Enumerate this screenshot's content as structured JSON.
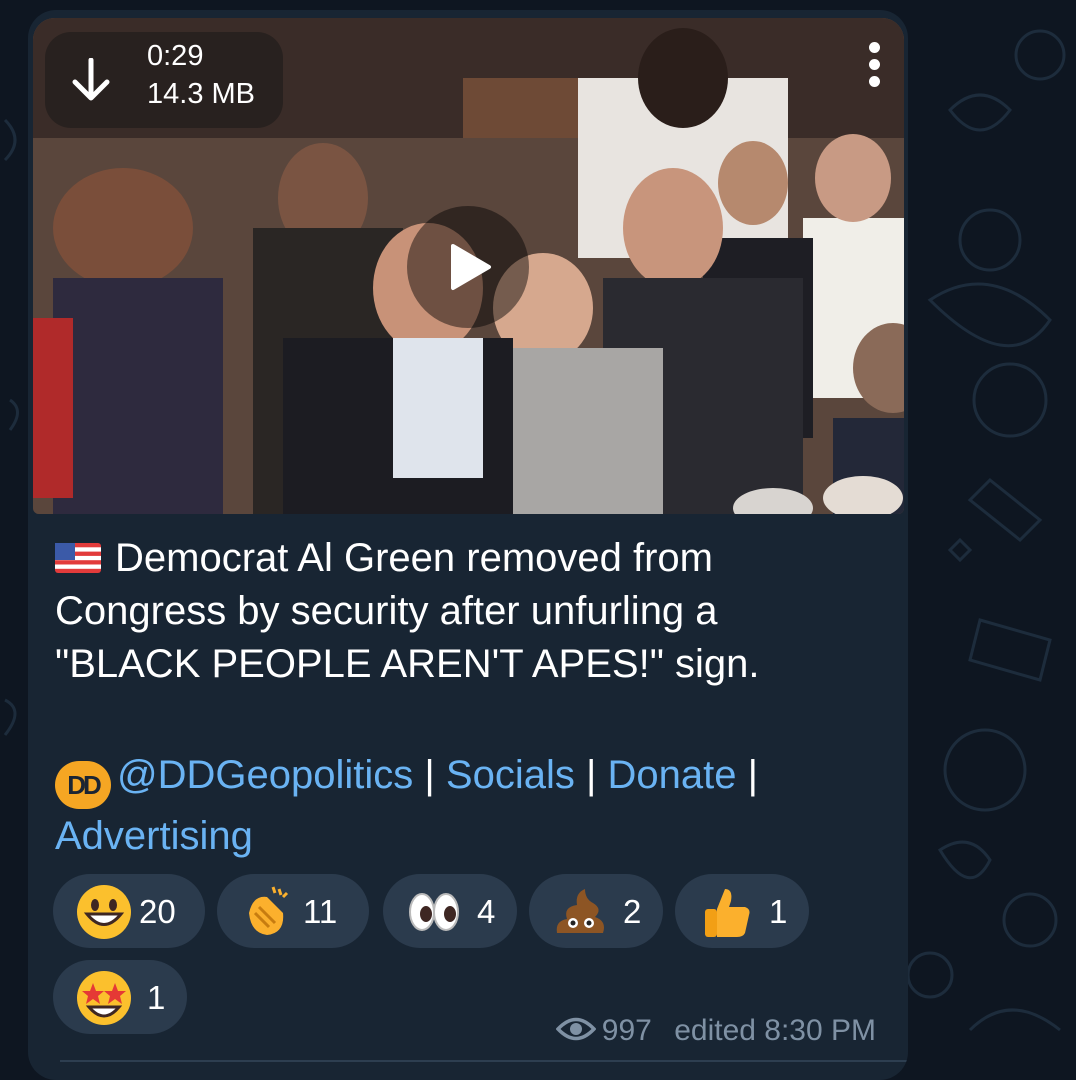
{
  "video": {
    "duration": "0:29",
    "size": "14.3 MB"
  },
  "caption": {
    "flag_icon": "us-flag-emoji",
    "text_line1": "Democrat Al Green removed from",
    "text_line2": "Congress by security after unfurling a",
    "text_line3": "\"BLACK PEOPLE AREN'T APES!\" sign."
  },
  "links": {
    "handle": "@DDGeopolitics",
    "socials": "Socials",
    "donate": "Donate",
    "advertising": "Advertising",
    "separator": "|",
    "logo_text": "DD"
  },
  "reactions": [
    {
      "emoji": "grinning-face",
      "count": "20"
    },
    {
      "emoji": "clapping-hands",
      "count": "11"
    },
    {
      "emoji": "eyes",
      "count": "4"
    },
    {
      "emoji": "pile-of-poo",
      "count": "2"
    },
    {
      "emoji": "thumbs-up",
      "count": "1"
    },
    {
      "emoji": "star-struck",
      "count": "1"
    }
  ],
  "meta": {
    "views": "997",
    "edited_time": "edited 8:30 PM"
  },
  "colors": {
    "background": "#0e1621",
    "bubble": "#182533",
    "link": "#6ab3f3",
    "reaction_bg": "#2b3b4d",
    "meta": "#7f91a4"
  }
}
